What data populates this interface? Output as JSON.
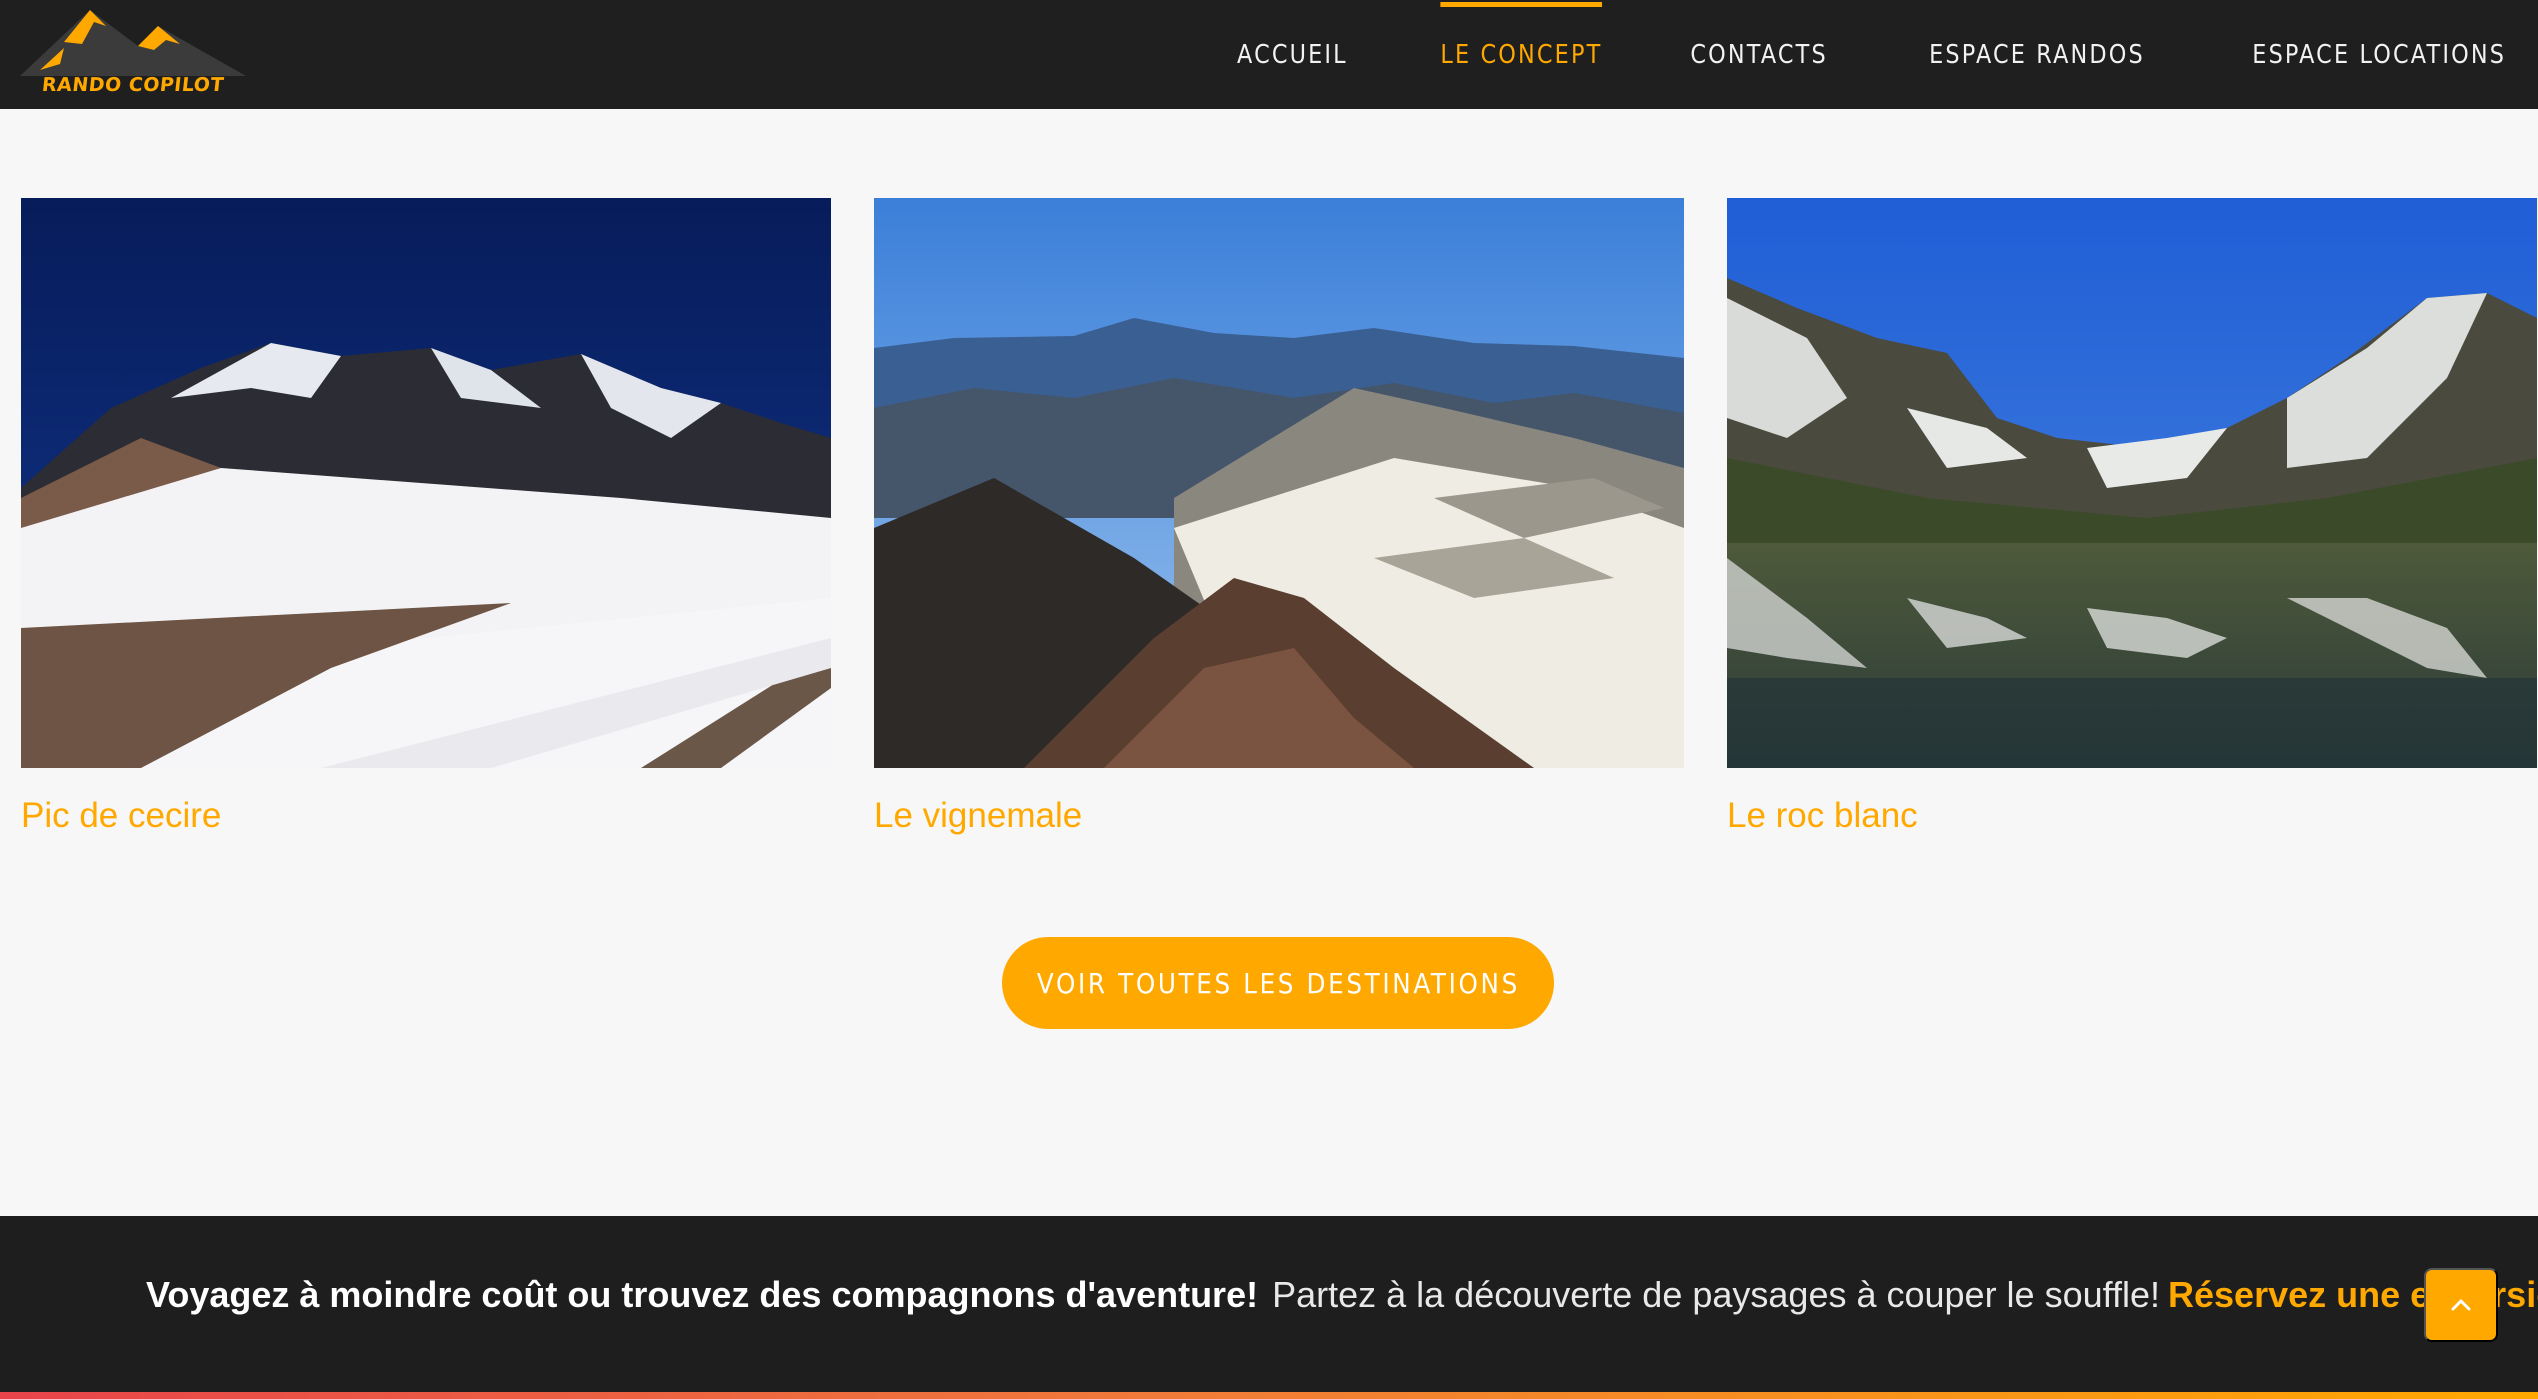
{
  "brand": {
    "name": "RANDO COPILOT",
    "accent": "#ffa800"
  },
  "nav": {
    "items": [
      {
        "label": "ACCUEIL"
      },
      {
        "label": "LE CONCEPT",
        "active": true
      },
      {
        "label": "CONTACTS"
      },
      {
        "label": "ESPACE RANDOS"
      },
      {
        "label": "ESPACE LOCATIONS"
      }
    ]
  },
  "destinations": [
    {
      "title": "Pic de cecire"
    },
    {
      "title": "Le vignemale"
    },
    {
      "title": "Le roc blanc"
    }
  ],
  "cta": {
    "label": "VOIR TOUTES LES DESTINATIONS"
  },
  "banner": {
    "bold": "Voyagez à moindre coût ou trouvez des compagnons d'aventure!",
    "light": "Partez à la découverte de paysages à couper le souffle!",
    "accent": "Réservez une excursion!"
  },
  "scroll_top": {
    "icon": "chevron-up-icon"
  }
}
